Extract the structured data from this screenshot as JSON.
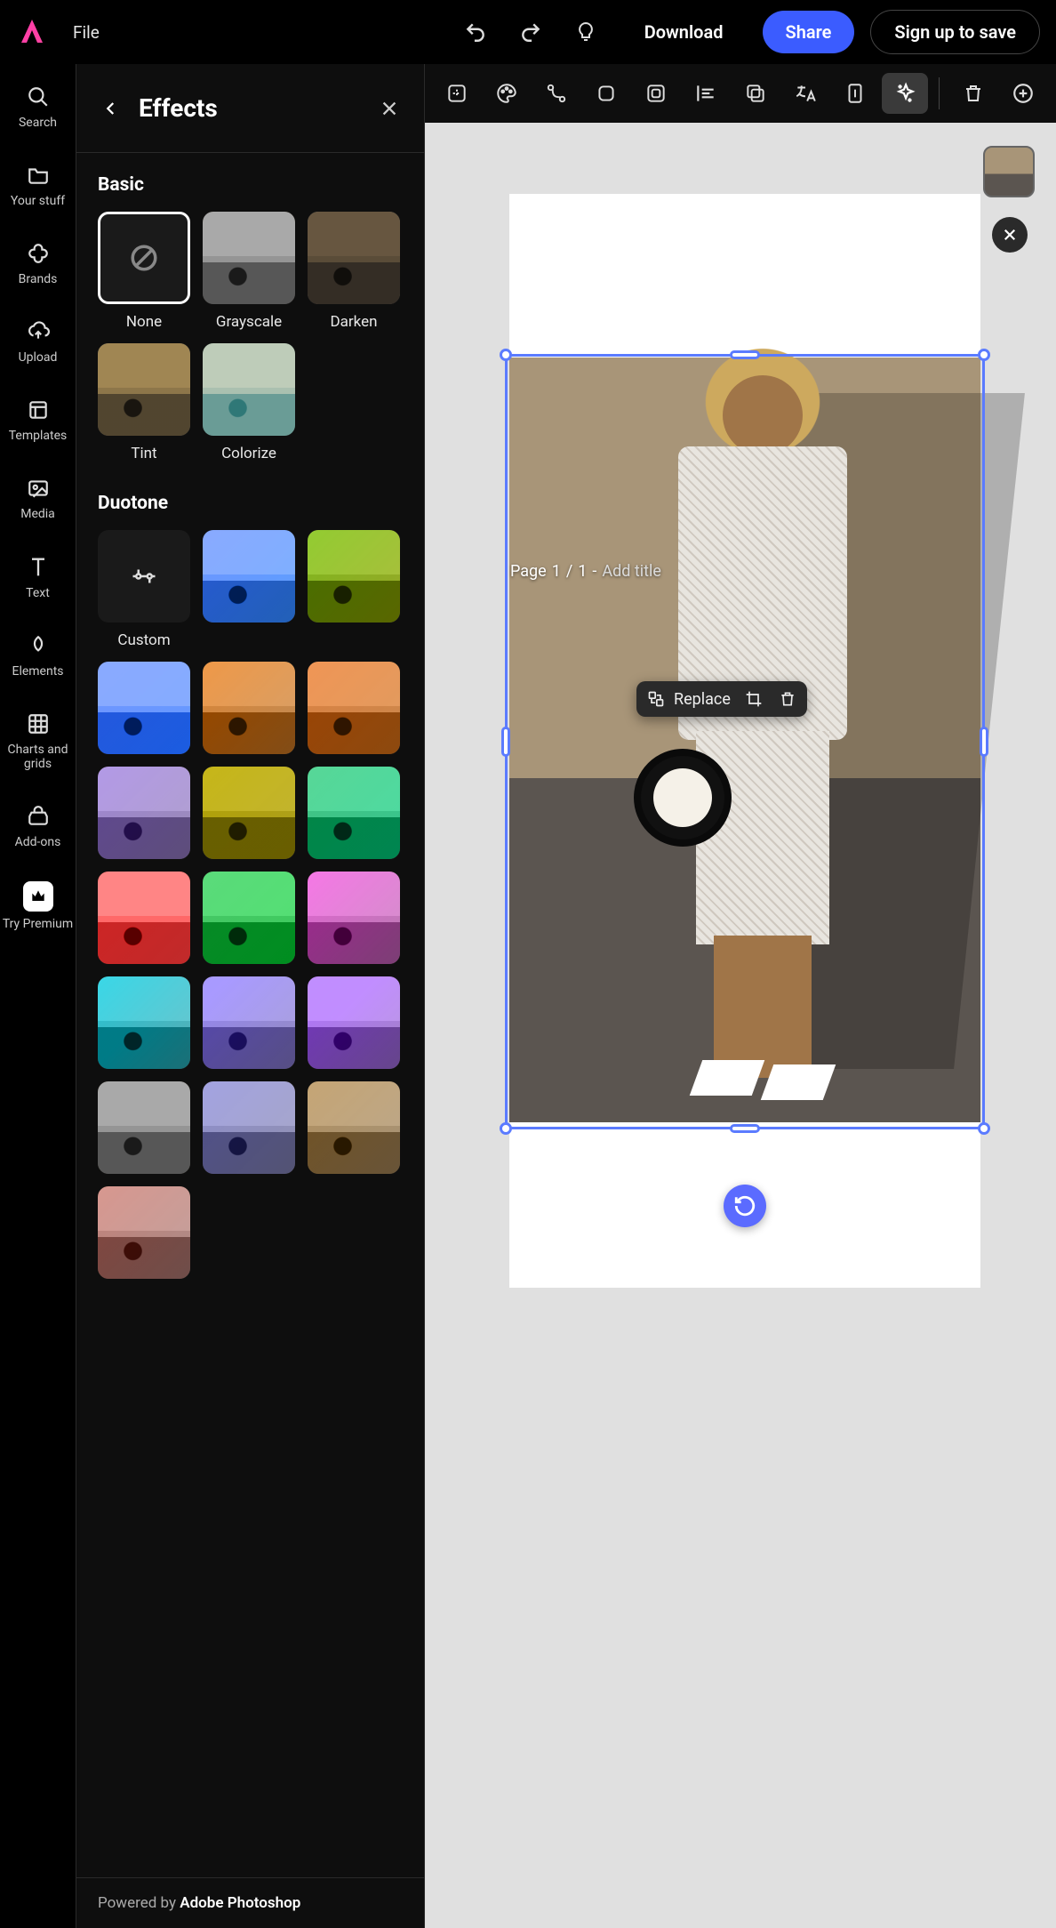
{
  "topbar": {
    "file_label": "File",
    "download_label": "Download",
    "share_label": "Share",
    "signup_label": "Sign up to save"
  },
  "rail": {
    "items": [
      {
        "icon": "search",
        "label": "Search"
      },
      {
        "icon": "folder",
        "label": "Your stuff"
      },
      {
        "icon": "brands",
        "label": "Brands"
      },
      {
        "icon": "upload",
        "label": "Upload"
      },
      {
        "icon": "templates",
        "label": "Templates"
      },
      {
        "icon": "media",
        "label": "Media"
      },
      {
        "icon": "text",
        "label": "Text"
      },
      {
        "icon": "elements",
        "label": "Elements"
      },
      {
        "icon": "charts",
        "label": "Charts and grids"
      },
      {
        "icon": "addons",
        "label": "Add-ons"
      },
      {
        "icon": "premium",
        "label": "Try Premium"
      }
    ]
  },
  "panel": {
    "title": "Effects",
    "basic_title": "Basic",
    "duotone_title": "Duotone",
    "basic": [
      {
        "id": "none",
        "label": "None",
        "selected": true
      },
      {
        "id": "grayscale",
        "label": "Grayscale",
        "tint": "#9a9a9a",
        "blend": "saturation"
      },
      {
        "id": "darken",
        "label": "Darken",
        "tint": "rgba(50,30,10,0.55)",
        "blend": "multiply"
      },
      {
        "id": "tint",
        "label": "Tint",
        "tint": "rgba(200,170,90,0.6)",
        "blend": "multiply"
      },
      {
        "id": "colorize",
        "label": "Colorize",
        "tint": "rgba(30,150,150,0.7)",
        "blend": "screen"
      }
    ],
    "custom_label": "Custom",
    "duotone": [
      {
        "c1": "#2a5bd8",
        "c2": "#6aa8ff"
      },
      {
        "c1": "#9bd43a",
        "c2": "#d9e96a"
      },
      {
        "c1": "#1a4bd0",
        "c2": "#3a7bff"
      },
      {
        "c1": "#e08a3a",
        "c2": "#f5c08a"
      },
      {
        "c1": "#c46a2a",
        "c2": "#e8a56a"
      },
      {
        "c1": "#b49be8",
        "c2": "#d8c8f5"
      },
      {
        "c1": "#c8b81a",
        "c2": "#e8da5a"
      },
      {
        "c1": "#1a9a5a",
        "c2": "#4ad8a0"
      },
      {
        "c1": "#c81a1a",
        "c2": "#f05a5a"
      },
      {
        "c1": "#1a9a3a",
        "c2": "#4ad86a"
      },
      {
        "c1": "#e86ad8",
        "c2": "#f5b8ee"
      },
      {
        "c1": "#3ad8e8",
        "c2": "#9aeef5"
      },
      {
        "c1": "#8a7ae8",
        "c2": "#c8c0f5"
      },
      {
        "c1": "#9a5ae8",
        "c2": "#d0b0f5"
      },
      {
        "c1": "#8a8a8a",
        "c2": "#c8c8c8"
      },
      {
        "c1": "#8a8ac8",
        "c2": "#c8c8e8"
      },
      {
        "c1": "#c8a878",
        "c2": "#e8d4b8"
      },
      {
        "c1": "#e8a8a0",
        "c2": "#f5d4d0"
      }
    ],
    "footer_prefix": "Powered by ",
    "footer_brand": "Adobe Photoshop"
  },
  "context_toolbar": {
    "items": [
      {
        "id": "generative",
        "icon": "sparkle"
      },
      {
        "id": "color",
        "icon": "palette"
      },
      {
        "id": "curve",
        "icon": "curve"
      },
      {
        "id": "shape",
        "icon": "rounded-square"
      },
      {
        "id": "mask",
        "icon": "mask"
      },
      {
        "id": "align",
        "icon": "align"
      },
      {
        "id": "layers",
        "icon": "stack"
      },
      {
        "id": "translate",
        "icon": "translate"
      },
      {
        "id": "page",
        "icon": "page"
      },
      {
        "id": "effects",
        "icon": "effects",
        "active": true
      }
    ]
  },
  "canvas": {
    "page_label_prefix": "Page",
    "page_current": "1",
    "page_total": "1",
    "page_separator": " / ",
    "add_title_placeholder": "Add title",
    "replace_label": "Replace"
  }
}
